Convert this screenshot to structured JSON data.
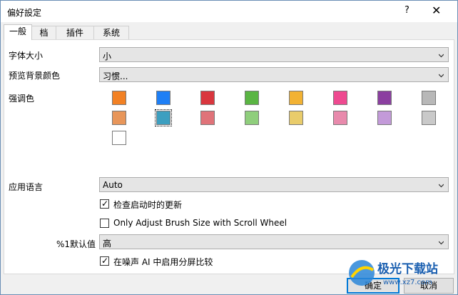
{
  "window": {
    "title": "偏好設定"
  },
  "tabs": [
    "一般",
    "档",
    "插件",
    "系统"
  ],
  "font_size": {
    "label": "字体大小",
    "value": "小"
  },
  "preview_bg": {
    "label": "预览背景颜色",
    "value": "习惯..."
  },
  "accent": {
    "label": "强调色",
    "row1": [
      "#f28124",
      "#1e7ff5",
      "#d9363e",
      "#5ab543",
      "#f2b233",
      "#ee4a90",
      "#8b3fa0",
      "#b8b8b8"
    ],
    "row2": [
      "#e8965a",
      "#3d9fc0",
      "#e07379",
      "#8fce7c",
      "#e9cc6b",
      "#e88aac",
      "#c39ad9",
      "#c9c9c9"
    ],
    "row3": [
      "#ffffff"
    ]
  },
  "app_lang": {
    "label": "应用语言",
    "value": "Auto"
  },
  "checkboxes": {
    "startup_update": "检查启动时的更新",
    "brush_wheel": "Only Adjust Brush Size with Scroll Wheel",
    "noise_split": "在噪声 AI 中启用分屏比较"
  },
  "default_value": {
    "label": "%1默认值",
    "value": "高"
  },
  "buttons": {
    "ok": "确定",
    "cancel": "取消"
  },
  "watermark": {
    "text1": "极光下载站",
    "text2": "www.xz7.com"
  }
}
